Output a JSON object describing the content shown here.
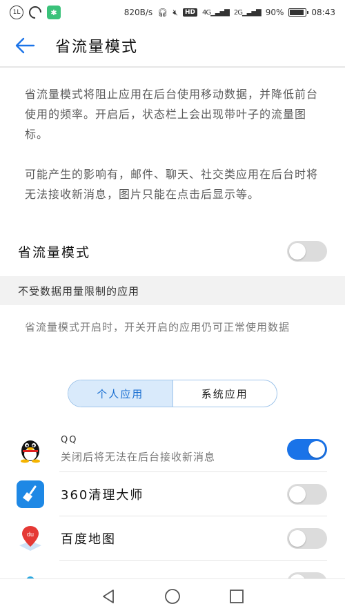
{
  "status_bar": {
    "speed": "820B/s",
    "net1": "4G",
    "net2": "2G",
    "battery": "90%",
    "time": "08:43"
  },
  "header": {
    "title": "省流量模式",
    "back_icon": "arrow-left-icon"
  },
  "description": {
    "paragraph1": "省流量模式将阻止应用在后台使用移动数据，并降低前台使用的频率。开启后，状态栏上会出现带叶子的流量图标。",
    "paragraph2": "可能产生的影响有，邮件、聊天、社交类应用在后台时将无法接收新消息，图片只能在点击后显示等。"
  },
  "data_saver": {
    "label": "省流量模式",
    "enabled": false
  },
  "unrestricted_section": {
    "title": "不受数据用量限制的应用",
    "description": "省流量模式开启时，开关开启的应用仍可正常使用数据"
  },
  "tabs": [
    {
      "label": "个人应用",
      "active": true
    },
    {
      "label": "系统应用",
      "active": false
    }
  ],
  "apps": [
    {
      "name": "QQ",
      "subtitle": "关闭后将无法在后台接收新消息",
      "enabled": true
    },
    {
      "name": "360清理大师",
      "enabled": false
    },
    {
      "name": "百度地图",
      "enabled": false
    }
  ],
  "colors": {
    "accent": "#1a73e8",
    "toggle_off": "#dcdcdc"
  }
}
